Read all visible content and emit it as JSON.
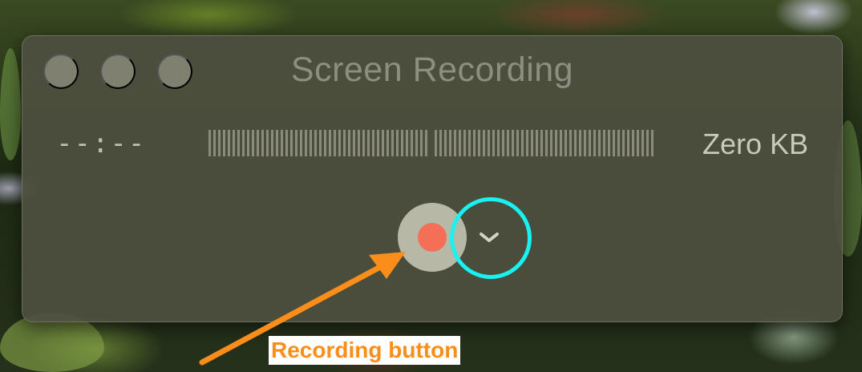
{
  "window": {
    "title": "Screen Recording",
    "traffic_lights": [
      "close-button",
      "minimize-button",
      "zoom-button"
    ]
  },
  "status": {
    "timecode": "--:--",
    "file_size": "Zero KB"
  },
  "audio_meter": {
    "level": 0
  },
  "controls": {
    "record_icon": "record-dot-icon",
    "options_icon": "chevron-down-icon"
  },
  "annotation": {
    "label": "Recording button",
    "label_color": "#fb8d1a",
    "arrow_color": "#fb8d1a",
    "highlight_color": "#18f2f2"
  },
  "colors": {
    "window_bg": "#4e503e",
    "record_button": "#b8b8a6",
    "record_dot": "#f46e58"
  }
}
